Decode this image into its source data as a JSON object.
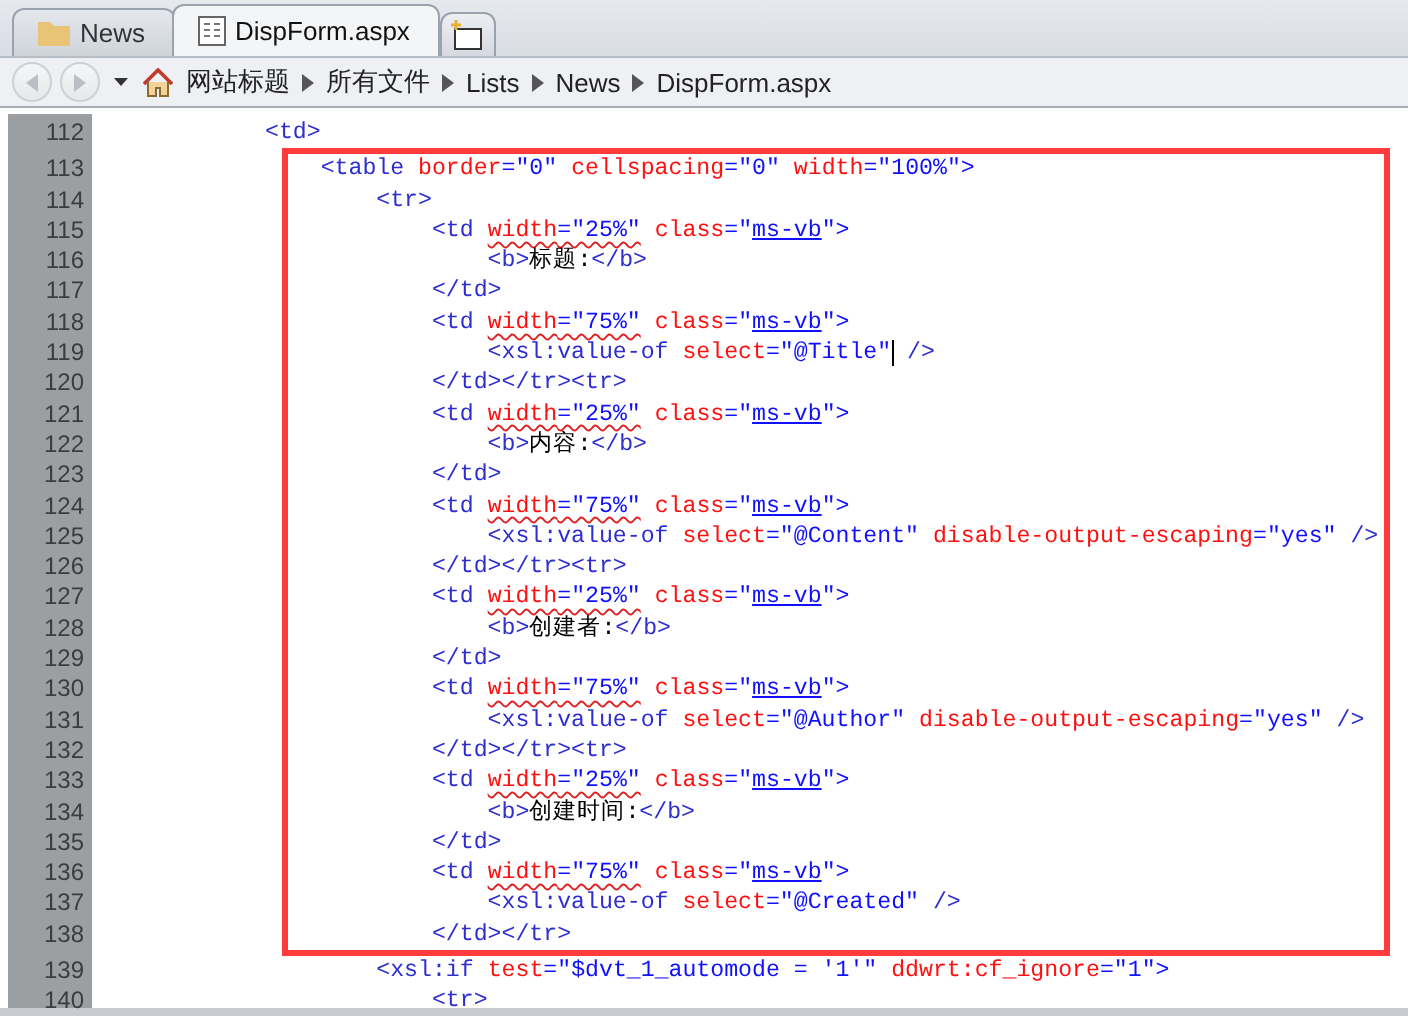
{
  "tabs": [
    {
      "label": "News",
      "kind": "folder",
      "selected": false
    },
    {
      "label": "DispForm.aspx",
      "kind": "document",
      "selected": true
    }
  ],
  "navigation": {
    "back": {
      "disabled": true
    },
    "forward": {
      "disabled": true
    }
  },
  "breadcrumb": [
    "网站标题",
    "所有文件",
    "Lists",
    "News",
    "DispForm.aspx"
  ],
  "lines_before": [
    {
      "number": "112",
      "tokens": [
        {
          "kind": "tag",
          "text": "            <td>"
        }
      ]
    }
  ],
  "highlighted_lines": [
    {
      "number": "113",
      "tokens": [
        {
          "kind": "tag",
          "text": "                <table"
        },
        {
          "kind": "attr",
          "text": " border"
        },
        {
          "kind": "value",
          "text": "=\"0\""
        },
        {
          "kind": "attr",
          "text": " cellspacing"
        },
        {
          "kind": "value",
          "text": "=\"0\""
        },
        {
          "kind": "attr",
          "text": " width"
        },
        {
          "kind": "value",
          "text": "=\"100%\">"
        }
      ]
    },
    {
      "number": "114",
      "tokens": [
        {
          "kind": "tag",
          "text": "                    <tr>"
        }
      ]
    },
    {
      "number": "115",
      "tokens": [
        {
          "kind": "tag",
          "text": "                        <td "
        },
        {
          "kind": "attr",
          "text": "width",
          "spelling_error": true
        },
        {
          "kind": "value",
          "text": "=\"25%\"",
          "spelling_error": true
        },
        {
          "kind": "attr",
          "text": " class"
        },
        {
          "kind": "value",
          "text": "=\""
        },
        {
          "kind": "link",
          "text": "ms-vb"
        },
        {
          "kind": "value",
          "text": "\">"
        }
      ]
    },
    {
      "number": "116",
      "tokens": [
        {
          "kind": "tag",
          "text": "                            <b>"
        },
        {
          "kind": "text",
          "text": "标题:"
        },
        {
          "kind": "tag",
          "text": "</b>"
        }
      ]
    },
    {
      "number": "117",
      "tokens": [
        {
          "kind": "tag",
          "text": "                        </td>"
        }
      ]
    },
    {
      "number": "118",
      "tokens": [
        {
          "kind": "tag",
          "text": "                        <td "
        },
        {
          "kind": "attr",
          "text": "width",
          "spelling_error": true
        },
        {
          "kind": "value",
          "text": "=\"75%\"",
          "spelling_error": true
        },
        {
          "kind": "attr",
          "text": " class"
        },
        {
          "kind": "value",
          "text": "=\""
        },
        {
          "kind": "link",
          "text": "ms-vb"
        },
        {
          "kind": "value",
          "text": "\">"
        }
      ]
    },
    {
      "number": "119",
      "tokens": [
        {
          "kind": "tag",
          "text": "                            <xsl:value-of"
        },
        {
          "kind": "attr",
          "text": " select"
        },
        {
          "kind": "value",
          "text": "=\"@Title\""
        },
        {
          "kind": "caret"
        },
        {
          "kind": "tag",
          "text": " />"
        }
      ]
    },
    {
      "number": "120",
      "tokens": [
        {
          "kind": "tag",
          "text": "                        </td></tr><tr>"
        }
      ]
    },
    {
      "number": "121",
      "tokens": [
        {
          "kind": "tag",
          "text": "                        <td "
        },
        {
          "kind": "attr",
          "text": "width",
          "spelling_error": true
        },
        {
          "kind": "value",
          "text": "=\"25%\"",
          "spelling_error": true
        },
        {
          "kind": "attr",
          "text": " class"
        },
        {
          "kind": "value",
          "text": "=\""
        },
        {
          "kind": "link",
          "text": "ms-vb"
        },
        {
          "kind": "value",
          "text": "\">"
        }
      ]
    },
    {
      "number": "122",
      "tokens": [
        {
          "kind": "tag",
          "text": "                            <b>"
        },
        {
          "kind": "text",
          "text": "内容:"
        },
        {
          "kind": "tag",
          "text": "</b>"
        }
      ]
    },
    {
      "number": "123",
      "tokens": [
        {
          "kind": "tag",
          "text": "                        </td>"
        }
      ]
    },
    {
      "number": "124",
      "tokens": [
        {
          "kind": "tag",
          "text": "                        <td "
        },
        {
          "kind": "attr",
          "text": "width",
          "spelling_error": true
        },
        {
          "kind": "value",
          "text": "=\"75%\"",
          "spelling_error": true
        },
        {
          "kind": "attr",
          "text": " class"
        },
        {
          "kind": "value",
          "text": "=\""
        },
        {
          "kind": "link",
          "text": "ms-vb"
        },
        {
          "kind": "value",
          "text": "\">"
        }
      ]
    },
    {
      "number": "125",
      "tokens": [
        {
          "kind": "tag",
          "text": "                            <xsl:value-of"
        },
        {
          "kind": "attr",
          "text": " select"
        },
        {
          "kind": "value",
          "text": "=\"@Content\""
        },
        {
          "kind": "attr",
          "text": " disable-output-escaping"
        },
        {
          "kind": "value",
          "text": "=\"yes\""
        },
        {
          "kind": "tag",
          "text": " />"
        }
      ]
    },
    {
      "number": "126",
      "tokens": [
        {
          "kind": "tag",
          "text": "                        </td></tr><tr>"
        }
      ]
    },
    {
      "number": "127",
      "tokens": [
        {
          "kind": "tag",
          "text": "                        <td "
        },
        {
          "kind": "attr",
          "text": "width",
          "spelling_error": true
        },
        {
          "kind": "value",
          "text": "=\"25%\"",
          "spelling_error": true
        },
        {
          "kind": "attr",
          "text": " class"
        },
        {
          "kind": "value",
          "text": "=\""
        },
        {
          "kind": "link",
          "text": "ms-vb"
        },
        {
          "kind": "value",
          "text": "\">"
        }
      ]
    },
    {
      "number": "128",
      "tokens": [
        {
          "kind": "tag",
          "text": "                            <b>"
        },
        {
          "kind": "text",
          "text": "创建者:"
        },
        {
          "kind": "tag",
          "text": "</b>"
        }
      ]
    },
    {
      "number": "129",
      "tokens": [
        {
          "kind": "tag",
          "text": "                        </td>"
        }
      ]
    },
    {
      "number": "130",
      "tokens": [
        {
          "kind": "tag",
          "text": "                        <td "
        },
        {
          "kind": "attr",
          "text": "width",
          "spelling_error": true
        },
        {
          "kind": "value",
          "text": "=\"75%\"",
          "spelling_error": true
        },
        {
          "kind": "attr",
          "text": " class"
        },
        {
          "kind": "value",
          "text": "=\""
        },
        {
          "kind": "link",
          "text": "ms-vb"
        },
        {
          "kind": "value",
          "text": "\">"
        }
      ]
    },
    {
      "number": "131",
      "tokens": [
        {
          "kind": "tag",
          "text": "                            <xsl:value-of"
        },
        {
          "kind": "attr",
          "text": " select"
        },
        {
          "kind": "value",
          "text": "=\"@Author\""
        },
        {
          "kind": "attr",
          "text": " disable-output-escaping"
        },
        {
          "kind": "value",
          "text": "=\"yes\""
        },
        {
          "kind": "tag",
          "text": " />"
        }
      ]
    },
    {
      "number": "132",
      "tokens": [
        {
          "kind": "tag",
          "text": "                        </td></tr><tr>"
        }
      ]
    },
    {
      "number": "133",
      "tokens": [
        {
          "kind": "tag",
          "text": "                        <td "
        },
        {
          "kind": "attr",
          "text": "width",
          "spelling_error": true
        },
        {
          "kind": "value",
          "text": "=\"25%\"",
          "spelling_error": true
        },
        {
          "kind": "attr",
          "text": " class"
        },
        {
          "kind": "value",
          "text": "=\""
        },
        {
          "kind": "link",
          "text": "ms-vb"
        },
        {
          "kind": "value",
          "text": "\">"
        }
      ]
    },
    {
      "number": "134",
      "tokens": [
        {
          "kind": "tag",
          "text": "                            <b>"
        },
        {
          "kind": "text",
          "text": "创建时间:"
        },
        {
          "kind": "tag",
          "text": "</b>"
        }
      ]
    },
    {
      "number": "135",
      "tokens": [
        {
          "kind": "tag",
          "text": "                        </td>"
        }
      ]
    },
    {
      "number": "136",
      "tokens": [
        {
          "kind": "tag",
          "text": "                        <td "
        },
        {
          "kind": "attr",
          "text": "width",
          "spelling_error": true
        },
        {
          "kind": "value",
          "text": "=\"75%\"",
          "spelling_error": true
        },
        {
          "kind": "attr",
          "text": " class"
        },
        {
          "kind": "value",
          "text": "=\""
        },
        {
          "kind": "link",
          "text": "ms-vb"
        },
        {
          "kind": "value",
          "text": "\">"
        }
      ]
    },
    {
      "number": "137",
      "tokens": [
        {
          "kind": "tag",
          "text": "                            <xsl:value-of"
        },
        {
          "kind": "attr",
          "text": " select"
        },
        {
          "kind": "value",
          "text": "=\"@Created\""
        },
        {
          "kind": "tag",
          "text": " />"
        }
      ]
    },
    {
      "number": "138",
      "tokens": [
        {
          "kind": "tag",
          "text": "                        </td></tr>"
        }
      ]
    }
  ],
  "lines_after": [
    {
      "number": "139",
      "tokens": [
        {
          "kind": "tag",
          "text": "                    <xsl:if"
        },
        {
          "kind": "attr",
          "text": " test"
        },
        {
          "kind": "value",
          "text": "=\"$dvt_1_automode = '1'\""
        },
        {
          "kind": "attr",
          "text": " ddwrt:cf_ignore"
        },
        {
          "kind": "value",
          "text": "=\"1\">"
        }
      ]
    },
    {
      "number": "140",
      "tokens": [
        {
          "kind": "tag",
          "text": "                        <tr>"
        }
      ]
    }
  ]
}
